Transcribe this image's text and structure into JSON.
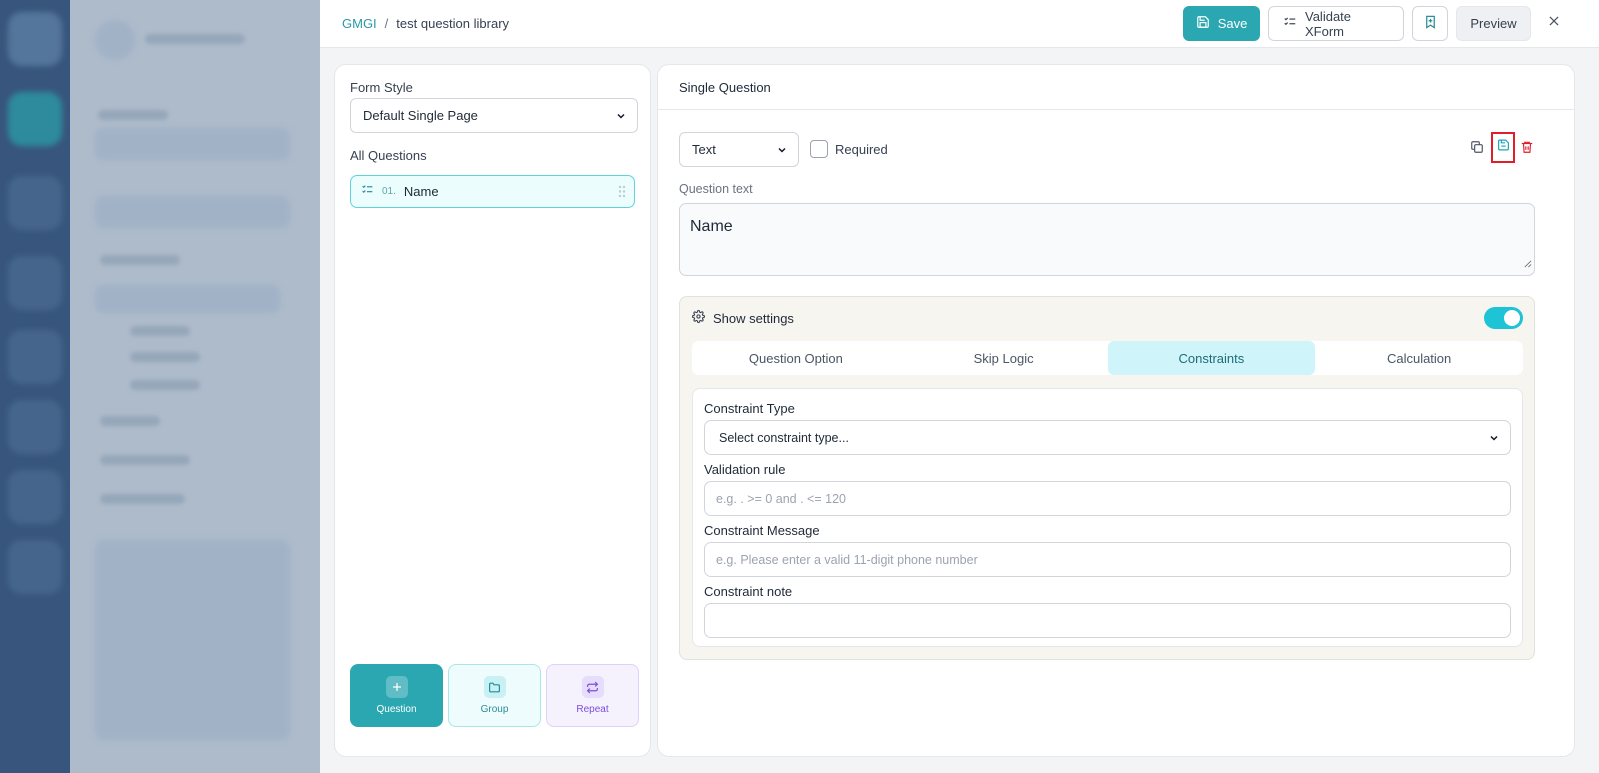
{
  "breadcrumb": {
    "org": "GMGI",
    "separator": "/",
    "page": "test question library"
  },
  "toolbar": {
    "save_label": "Save",
    "validate_label": "Validate XForm",
    "preview_label": "Preview"
  },
  "left_panel": {
    "form_style_label": "Form Style",
    "form_style_value": "Default Single Page",
    "all_questions_label": "All Questions",
    "questions": [
      {
        "number": "01.",
        "name": "Name"
      }
    ],
    "add_buttons": {
      "question": "Question",
      "group": "Group",
      "repeat": "Repeat"
    }
  },
  "editor": {
    "header": "Single Question",
    "type_value": "Text",
    "required_label": "Required",
    "question_text_label": "Question text",
    "question_text_value": "Name",
    "settings_label": "Show settings",
    "tabs": [
      "Question Option",
      "Skip Logic",
      "Constraints",
      "Calculation"
    ],
    "constraints": {
      "type_label": "Constraint Type",
      "type_value": "Select constraint type...",
      "validation_label": "Validation rule",
      "validation_placeholder": "e.g. . >= 0 and . <= 120",
      "message_label": "Constraint Message",
      "message_placeholder": "e.g. Please enter a valid 11-digit phone number",
      "note_label": "Constraint note",
      "note_value": ""
    }
  },
  "colors": {
    "accent": "#2ba7b2",
    "toggle": "#1fc3d6",
    "danger": "#e11d2a",
    "active_tab": "#cff5fa"
  }
}
